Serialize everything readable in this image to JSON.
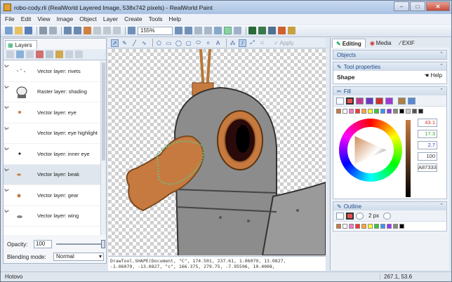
{
  "window": {
    "title": "robo-cody.rli (RealWorld Layered Image, 538x742 pixels) - RealWorld Paint",
    "min": "–",
    "max": "□",
    "close": "✕"
  },
  "menu": [
    "File",
    "Edit",
    "View",
    "Image",
    "Object",
    "Layer",
    "Create",
    "Tools",
    "Help"
  ],
  "toolbar": {
    "zoom": "155%"
  },
  "layers_panel": {
    "tab": "Layers",
    "items": [
      {
        "label": "Vector layer: rivets"
      },
      {
        "label": "Raster layer: shading"
      },
      {
        "label": "Vector layer: eye"
      },
      {
        "label": "Vector layer: eye highlight"
      },
      {
        "label": "Vector layer: inner eye"
      },
      {
        "label": "Vector layer: beak",
        "selected": true
      },
      {
        "label": "Vector layer: gear"
      },
      {
        "label": "Vector layer: wing"
      }
    ],
    "opacity_label": "Opacity:",
    "opacity_value": "100",
    "blend_label": "Blending mode:",
    "blend_value": "Normal"
  },
  "tool_options": {
    "apply": "Apply"
  },
  "console": {
    "line1": "DrawTool.SHAPE(Document, \"C\", 174.501, 237.61, 1.06079, 13.0827,",
    "line2": "-1.06079, -13.0827, \"c\", 166.375, 279.75, -7.95596, 10.4008,"
  },
  "right_panel": {
    "tabs": [
      "Editing",
      "Media",
      "EXIF"
    ],
    "objects": "Objects",
    "tool_properties": "Tool properties",
    "shape": "Shape",
    "help": "Help",
    "fill": "Fill",
    "values": [
      "43.1",
      "17.3",
      "2.7",
      "100",
      "A87333"
    ],
    "outline": "Outline",
    "outline_width": "2 px"
  },
  "status": {
    "text": "Hotovo",
    "coords": "267.1, 53.6"
  },
  "colors": {
    "fill": "#e85050",
    "accent": "#c77a40"
  }
}
